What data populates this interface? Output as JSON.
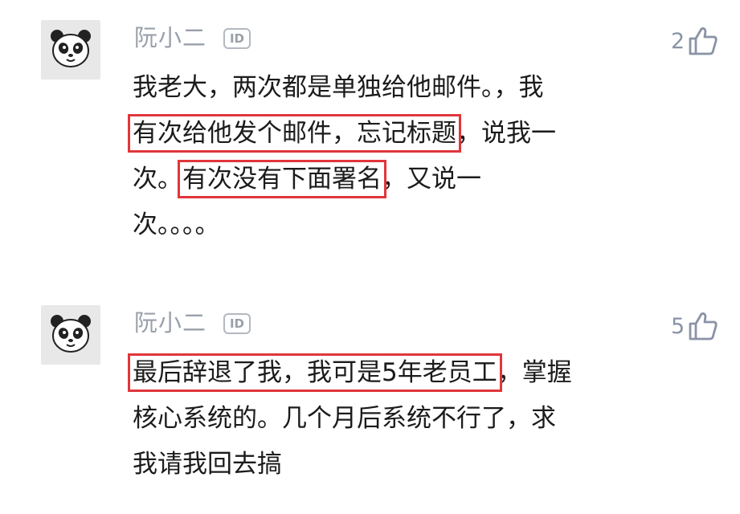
{
  "comments": [
    {
      "username": "阮小二",
      "id_badge": "ID",
      "likes": "2",
      "avatar_icon": "panda-icon",
      "lines": [
        [
          {
            "t": "我老大，两次都是单独给他邮件。，我",
            "hl": false
          }
        ],
        [
          {
            "t": "有次给他发个邮件，忘记标题",
            "hl": true
          },
          {
            "t": "，说我一",
            "hl": false
          }
        ],
        [
          {
            "t": "次。",
            "hl": false
          },
          {
            "t": "有次没有下面署名",
            "hl": true
          },
          {
            "t": "，又说一",
            "hl": false
          }
        ],
        [
          {
            "t": "次。。。。",
            "hl": false
          }
        ]
      ]
    },
    {
      "username": "阮小二",
      "id_badge": "ID",
      "likes": "5",
      "avatar_icon": "panda-icon",
      "lines": [
        [
          {
            "t": "最后辞退了我，我可是5年老员工",
            "hl": true
          },
          {
            "t": "，掌握",
            "hl": false
          }
        ],
        [
          {
            "t": "核心系统的。几个月后系统不行了，求",
            "hl": false
          }
        ],
        [
          {
            "t": "我请我回去搞",
            "hl": false
          }
        ]
      ]
    }
  ],
  "colors": {
    "highlight": "#e0363b",
    "username": "#9aa0aa",
    "text": "#1b1b1b",
    "like": "#8a93a6"
  }
}
